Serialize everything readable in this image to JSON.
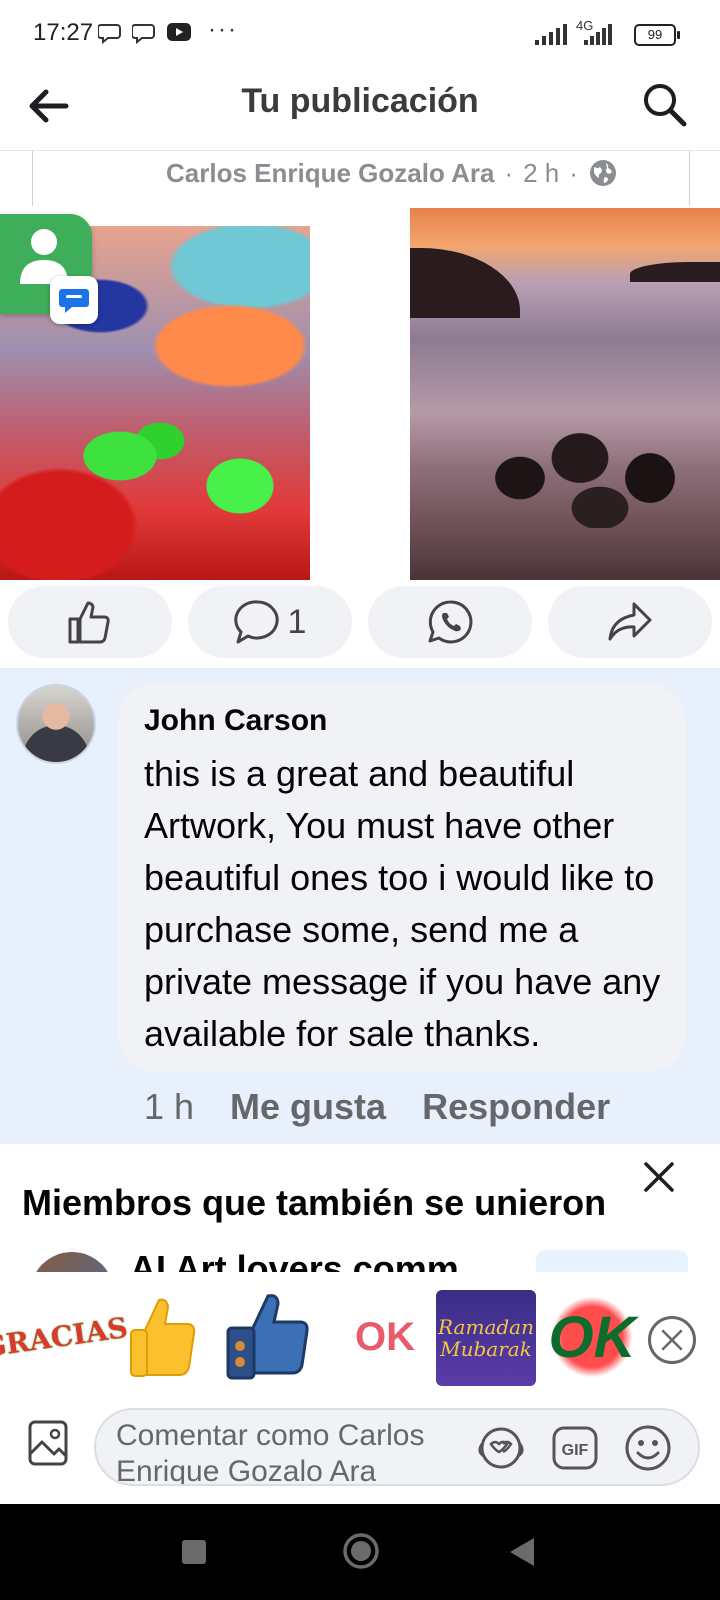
{
  "status_bar": {
    "time": "17:27",
    "dots": "···",
    "network": "4G",
    "battery": "99"
  },
  "header": {
    "title": "Tu publicación",
    "back_icon": "arrow-left-icon",
    "search_icon": "search-icon"
  },
  "post": {
    "author": "Carlos Enrique Gozalo Ara",
    "time": "2 h",
    "separator": "·",
    "privacy_icon": "globe-icon"
  },
  "actions": {
    "like_icon": "thumbs-up-icon",
    "comment_icon": "comment-icon",
    "comment_count": "1",
    "whatsapp_icon": "whatsapp-icon",
    "share_icon": "share-icon"
  },
  "comment": {
    "author": "John Carson",
    "text": "this is a great and beautiful Artwork, You must have other beautiful ones too i would like to purchase some, send me a private message if you have any available for sale thanks.",
    "time": "1 h",
    "like_label": "Me gusta",
    "reply_label": "Responder"
  },
  "members": {
    "heading": "Miembros que también se unieron",
    "peek_text": "AI Art lovers comm"
  },
  "stickers": {
    "gracias": "GRACIAS",
    "ok1": "OK",
    "ramadan_line1": "Ramadan",
    "ramadan_line2": "Mubarak",
    "ok2": "OK"
  },
  "composer": {
    "placeholder": "Comentar como Carlos Enrique Gozalo Ara"
  },
  "colors": {
    "brand_blue": "#1877f2",
    "comment_highlight": "#e7f0fb",
    "bubble": "#f0f2f5",
    "muted_text": "#65676b"
  }
}
